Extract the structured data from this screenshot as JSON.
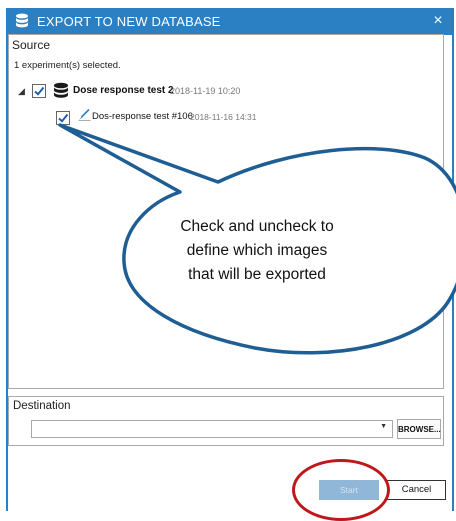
{
  "dialog": {
    "title": "EXPORT TO NEW DATABASE",
    "title_icon": "database-icon",
    "close_label": "×",
    "colors": {
      "titlebar": "#2b80c4",
      "check": "#1f5fa6",
      "annotation": "#c0181a"
    }
  },
  "source": {
    "label": "Source",
    "selected_count": "1 experiment(s) selected.",
    "experiment": {
      "name": "Dose response test 2",
      "date": "2018-11-19 10:20",
      "checked": true,
      "icon": "database-icon",
      "tests": [
        {
          "name": "Dos-response test #106",
          "date": "2018-11-16 14:31",
          "checked": true,
          "icon": "pipette-icon"
        }
      ]
    }
  },
  "callout": {
    "lines": [
      "Check and uncheck to",
      "define which images",
      "that will be exported"
    ]
  },
  "destination": {
    "label": "Destination",
    "value": "",
    "browse_label": "BROWSE..."
  },
  "buttons": {
    "start_label": "Start",
    "cancel_label": "Cancel"
  }
}
